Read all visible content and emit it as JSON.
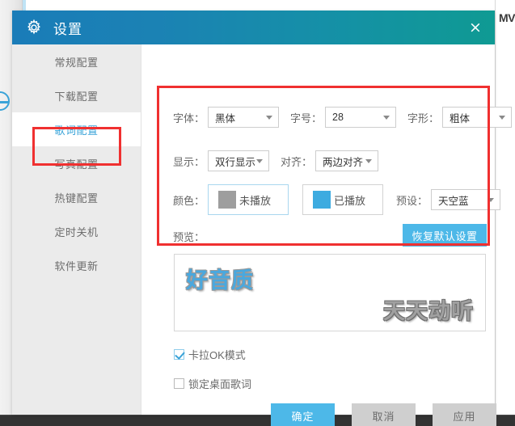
{
  "background": {
    "mv_label": "MV",
    "circle_icon": "collapse-circle-icon"
  },
  "dialog": {
    "title": "设置",
    "gear_icon": "gear-icon",
    "close_icon": "×"
  },
  "sidebar": {
    "items": [
      {
        "label": "常规配置",
        "active": false
      },
      {
        "label": "下载配置",
        "active": false
      },
      {
        "label": "歌词配置",
        "active": true
      },
      {
        "label": "写真配置",
        "active": false
      },
      {
        "label": "热键配置",
        "active": false
      },
      {
        "label": "定时关机",
        "active": false
      },
      {
        "label": "软件更新",
        "active": false
      }
    ]
  },
  "form": {
    "font": {
      "label": "字体：",
      "value": "黑体"
    },
    "size": {
      "label": "字号：",
      "value": "28"
    },
    "style": {
      "label": "字形：",
      "value": "粗体"
    },
    "display": {
      "label": "显示：",
      "value": "双行显示"
    },
    "align": {
      "label": "对齐：",
      "value": "两边对齐"
    },
    "color": {
      "label": "颜色：",
      "unplayed": {
        "text": "未播放",
        "swatch": "#9e9e9e"
      },
      "played": {
        "text": "已播放",
        "swatch": "#3dabe0"
      }
    },
    "preset": {
      "label": "预设：",
      "value": "天空蓝"
    },
    "preview": {
      "label": "预览："
    },
    "restore_defaults_label": "恢复默认设置"
  },
  "preview": {
    "played_line": "好音质",
    "unplayed_line": "天天动听"
  },
  "options": {
    "karaoke": {
      "label": "卡拉OK模式",
      "checked": true
    },
    "lock_desktop_lyrics": {
      "label": "锁定桌面歌词",
      "checked": false
    }
  },
  "footer": {
    "ok_label": "确定",
    "cancel_label": "取消",
    "apply_label": "应用"
  },
  "colors": {
    "title_gradient_start": "#1a7cb8",
    "title_gradient_end": "#0f9a93",
    "accent": "#4db8e8",
    "annotation_red": "#f03030",
    "sidebar_bg": "#ebebeb"
  }
}
